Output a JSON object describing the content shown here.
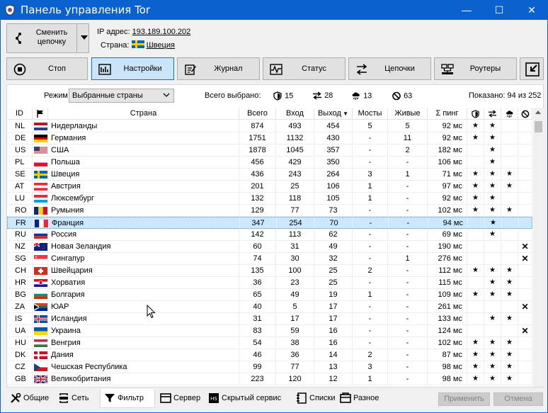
{
  "window": {
    "title": "Панель управления Tor",
    "minimize": "—",
    "maximize": "☐",
    "close": "✕",
    "colors": {
      "titlebar": "#0b62cf"
    }
  },
  "chain": {
    "label_line1": "Сменить",
    "label_line2": "цепочку"
  },
  "ip_info": {
    "ip_label": "IP адрес:",
    "ip_value": "193.189.100.202",
    "country_label": "Страна:",
    "country_value": "Швеция",
    "country_flag": "SE"
  },
  "nav": [
    {
      "label": "Стоп",
      "icon": "stop-icon",
      "active": false
    },
    {
      "label": "Настройки",
      "icon": "settings-icon",
      "active": true
    },
    {
      "label": "Журнал",
      "icon": "journal-icon",
      "active": false
    },
    {
      "label": "Статус",
      "icon": "status-icon",
      "active": false
    },
    {
      "label": "Цепочки",
      "icon": "chains-icon",
      "active": false
    },
    {
      "label": "Роутеры",
      "icon": "routers-icon",
      "active": false
    }
  ],
  "filter": {
    "mode_label": "Режим",
    "mode_value": "Выбранные страны",
    "total_label": "Всего выбрано:",
    "guard_count": "15",
    "exit_count": "28",
    "bridge_count": "13",
    "excluded_count": "63",
    "shown_text": "Показано: 94 из 252"
  },
  "table": {
    "headers": {
      "id": "ID",
      "country": "Страна",
      "total": "Всего",
      "in": "Вход",
      "out": "Выход",
      "bridges": "Мосты",
      "alive": "Живые",
      "ping": "Σ пинг"
    },
    "rows": [
      {
        "id": "NL",
        "name": "Нидерланды",
        "total": "874",
        "in": "493",
        "out": "454",
        "bridges": "5",
        "alive": "5",
        "ping": "92 мс",
        "g": "★",
        "e": "★",
        "x": "",
        "b": ""
      },
      {
        "id": "DE",
        "name": "Германия",
        "total": "1751",
        "in": "1132",
        "out": "430",
        "bridges": "-",
        "alive": "11",
        "ping": "92 мс",
        "g": "★",
        "e": "★",
        "x": "",
        "b": ""
      },
      {
        "id": "US",
        "name": "США",
        "total": "1878",
        "in": "1045",
        "out": "357",
        "bridges": "-",
        "alive": "2",
        "ping": "182 мс",
        "g": "",
        "e": "★",
        "x": "",
        "b": ""
      },
      {
        "id": "PL",
        "name": "Польша",
        "total": "456",
        "in": "429",
        "out": "350",
        "bridges": "-",
        "alive": "-",
        "ping": "106 мс",
        "g": "",
        "e": "★",
        "x": "",
        "b": ""
      },
      {
        "id": "SE",
        "name": "Швеция",
        "total": "436",
        "in": "243",
        "out": "264",
        "bridges": "3",
        "alive": "1",
        "ping": "71 мс",
        "g": "★",
        "e": "★",
        "x": "★",
        "b": ""
      },
      {
        "id": "AT",
        "name": "Австрия",
        "total": "201",
        "in": "25",
        "out": "106",
        "bridges": "1",
        "alive": "-",
        "ping": "97 мс",
        "g": "★",
        "e": "★",
        "x": "★",
        "b": ""
      },
      {
        "id": "LU",
        "name": "Люксембург",
        "total": "132",
        "in": "118",
        "out": "105",
        "bridges": "1",
        "alive": "-",
        "ping": "92 мс",
        "g": "★",
        "e": "★",
        "x": "",
        "b": ""
      },
      {
        "id": "RO",
        "name": "Румыния",
        "total": "129",
        "in": "77",
        "out": "73",
        "bridges": "-",
        "alive": "-",
        "ping": "102 мс",
        "g": "★",
        "e": "★",
        "x": "★",
        "b": ""
      },
      {
        "id": "FR",
        "name": "Франция",
        "total": "347",
        "in": "254",
        "out": "70",
        "bridges": "-",
        "alive": "-",
        "ping": "94 мс",
        "g": "",
        "e": "★",
        "x": "",
        "b": ""
      },
      {
        "id": "RU",
        "name": "Россия",
        "total": "142",
        "in": "113",
        "out": "62",
        "bridges": "-",
        "alive": "-",
        "ping": "69 мс",
        "g": "",
        "e": "★",
        "x": "",
        "b": ""
      },
      {
        "id": "NZ",
        "name": "Новая Зеландия",
        "total": "60",
        "in": "31",
        "out": "49",
        "bridges": "-",
        "alive": "-",
        "ping": "190 мс",
        "g": "",
        "e": "",
        "x": "",
        "b": "✕"
      },
      {
        "id": "SG",
        "name": "Сингапур",
        "total": "74",
        "in": "30",
        "out": "32",
        "bridges": "-",
        "alive": "1",
        "ping": "276 мс",
        "g": "",
        "e": "",
        "x": "",
        "b": "✕"
      },
      {
        "id": "CH",
        "name": "Швейцария",
        "total": "135",
        "in": "100",
        "out": "25",
        "bridges": "2",
        "alive": "-",
        "ping": "112 мс",
        "g": "★",
        "e": "★",
        "x": "★",
        "b": ""
      },
      {
        "id": "HR",
        "name": "Хорватия",
        "total": "36",
        "in": "23",
        "out": "25",
        "bridges": "-",
        "alive": "-",
        "ping": "115 мс",
        "g": "",
        "e": "★",
        "x": "★",
        "b": ""
      },
      {
        "id": "BG",
        "name": "Болгария",
        "total": "65",
        "in": "49",
        "out": "19",
        "bridges": "1",
        "alive": "-",
        "ping": "109 мс",
        "g": "★",
        "e": "★",
        "x": "★",
        "b": ""
      },
      {
        "id": "ZA",
        "name": "ЮАР",
        "total": "40",
        "in": "5",
        "out": "17",
        "bridges": "-",
        "alive": "-",
        "ping": "261 мс",
        "g": "",
        "e": "",
        "x": "",
        "b": "✕"
      },
      {
        "id": "IS",
        "name": "Исландия",
        "total": "31",
        "in": "17",
        "out": "17",
        "bridges": "-",
        "alive": "-",
        "ping": "133 мс",
        "g": "",
        "e": "★",
        "x": "★",
        "b": ""
      },
      {
        "id": "UA",
        "name": "Украина",
        "total": "83",
        "in": "59",
        "out": "16",
        "bridges": "-",
        "alive": "-",
        "ping": "124 мс",
        "g": "",
        "e": "",
        "x": "",
        "b": "✕"
      },
      {
        "id": "HU",
        "name": "Венгрия",
        "total": "54",
        "in": "38",
        "out": "16",
        "bridges": "-",
        "alive": "-",
        "ping": "102 мс",
        "g": "★",
        "e": "★",
        "x": "★",
        "b": ""
      },
      {
        "id": "DK",
        "name": "Дания",
        "total": "46",
        "in": "36",
        "out": "14",
        "bridges": "2",
        "alive": "-",
        "ping": "87 мс",
        "g": "★",
        "e": "★",
        "x": "★",
        "b": ""
      },
      {
        "id": "CZ",
        "name": "Чешская Республика",
        "total": "99",
        "in": "77",
        "out": "13",
        "bridges": "3",
        "alive": "-",
        "ping": "98 мс",
        "g": "★",
        "e": "★",
        "x": "★",
        "b": ""
      },
      {
        "id": "GB",
        "name": "Великобритания",
        "total": "223",
        "in": "120",
        "out": "12",
        "bridges": "1",
        "alive": "-",
        "ping": "98 мс",
        "g": "★",
        "e": "★",
        "x": "★",
        "b": ""
      }
    ]
  },
  "tabs": [
    {
      "label": "Общие",
      "icon": "tools-icon"
    },
    {
      "label": "Сеть",
      "icon": "network-icon"
    },
    {
      "label": "Фильтр",
      "icon": "filter-icon",
      "active": true
    },
    {
      "label": "Сервер",
      "icon": "server-icon"
    },
    {
      "label": "Скрытый сервис",
      "icon": "hidden-service-icon"
    },
    {
      "label": "Списки",
      "icon": "lists-icon"
    },
    {
      "label": "Разное",
      "icon": "misc-icon"
    }
  ],
  "footer": {
    "apply": "Применить",
    "cancel": "Отмена"
  }
}
